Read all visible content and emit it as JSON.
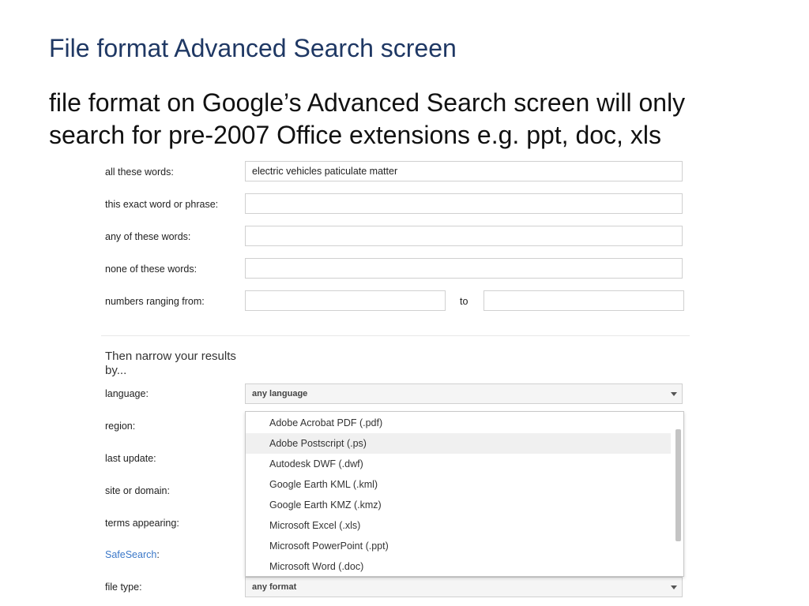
{
  "slide": {
    "title": "File format Advanced Search screen",
    "body_line1": "file format on Google’s Advanced Search screen will only",
    "body_line2": "search for pre-2007 Office extensions e.g. ppt, doc, xls"
  },
  "find_pages": {
    "all_words_label": "all these words:",
    "all_words_value": "electric vehicles paticulate matter",
    "exact_phrase_label": "this exact word or phrase:",
    "any_words_label": "any of these words:",
    "none_words_label": "none of these words:",
    "numbers_label": "numbers ranging from:",
    "numbers_to": "to"
  },
  "narrow": {
    "heading": "Then narrow your results by...",
    "language_label": "language:",
    "language_value": "any language",
    "region_label": "region:",
    "last_update_label": "last update:",
    "site_label": "site or domain:",
    "terms_label": "terms appearing:",
    "safesearch_label": "SafeSearch",
    "safesearch_colon": ":",
    "file_type_label": "file type:",
    "file_type_value": "any format"
  },
  "file_type_options": [
    "Adobe Acrobat PDF (.pdf)",
    "Adobe Postscript (.ps)",
    "Autodesk DWF (.dwf)",
    "Google Earth KML (.kml)",
    "Google Earth KMZ (.kmz)",
    "Microsoft Excel (.xls)",
    "Microsoft PowerPoint (.ppt)",
    "Microsoft Word (.doc)"
  ],
  "highlighted_option_index": 1,
  "colors": {
    "title": "#1f3864",
    "link": "#3b78c8"
  }
}
